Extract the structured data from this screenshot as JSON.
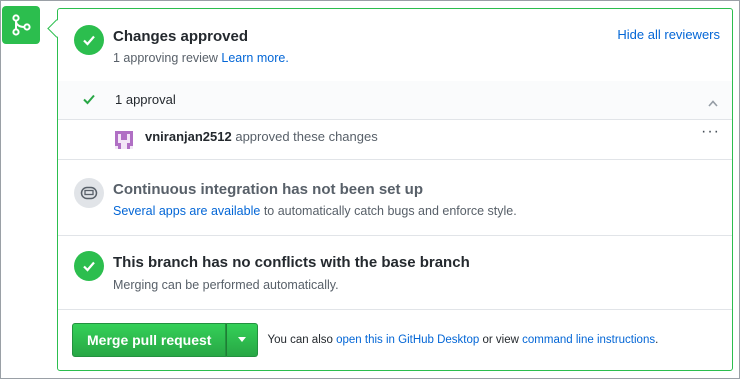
{
  "merge_box": {
    "approved": {
      "title": "Changes approved",
      "sub_text": "1 approving review",
      "learn_more": "Learn more.",
      "hide_reviewers": "Hide all reviewers"
    },
    "approvals": {
      "count_label": "1 approval",
      "reviewer_name": "vniranjan2512",
      "reviewer_action": "approved these changes",
      "more_label": "···"
    },
    "ci": {
      "title": "Continuous integration has not been set up",
      "link": "Several apps are available",
      "text": "to automatically catch bugs and enforce style."
    },
    "conflicts": {
      "title": "This branch has no conflicts with the base branch",
      "sub_text": "Merging can be performed automatically."
    },
    "merge": {
      "button_label": "Merge pull request",
      "note_prefix": "You can also",
      "desktop_link": "open this in GitHub Desktop",
      "note_middle": "or view",
      "cli_link": "command line instructions",
      "note_suffix": "."
    }
  },
  "colors": {
    "green": "#2cbe4e",
    "link_blue": "#0366d6",
    "muted_gray": "#586069",
    "avatar_purple": "#b06fc4"
  },
  "icons": [
    "git-merge-icon",
    "check-icon",
    "chevron-up-icon",
    "avatar",
    "kebab-icon",
    "ci-icon",
    "triangle-down-icon"
  ]
}
